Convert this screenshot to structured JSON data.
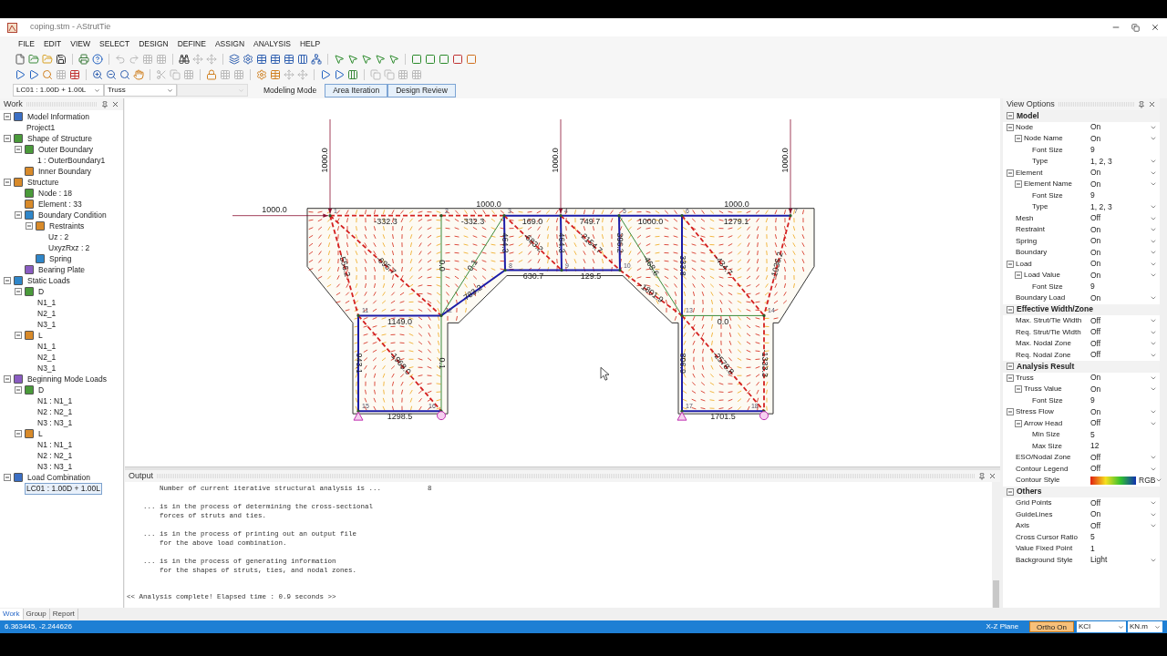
{
  "window": {
    "title": "coping.stm - AStrutTie"
  },
  "menu": [
    "FILE",
    "EDIT",
    "VIEW",
    "SELECT",
    "DESIGN",
    "DEFINE",
    "ASSIGN",
    "ANALYSIS",
    "HELP"
  ],
  "selector_bar": {
    "combination": "LC01 : 1.00D + 1.00L",
    "display": "Truss",
    "modes": [
      {
        "label": "Modeling Mode",
        "selected": false
      },
      {
        "label": "Area Iteration",
        "selected": true
      },
      {
        "label": "Design Review",
        "selected": true
      }
    ]
  },
  "work_panel": {
    "title": "Work",
    "tree": [
      {
        "label": "Model Information",
        "expanded": true,
        "selected": false,
        "children": [
          {
            "label": "Project1",
            "selected": false
          }
        ]
      },
      {
        "label": "Shape of Structure",
        "expanded": true,
        "selected": false,
        "children": [
          {
            "label": "Outer Boundary",
            "expanded": true,
            "selected": false,
            "children": [
              {
                "label": "1 : OuterBoundary1",
                "selected": false
              }
            ]
          },
          {
            "label": "Inner Boundary",
            "selected": false
          }
        ]
      },
      {
        "label": "Structure",
        "expanded": true,
        "selected": false,
        "children": [
          {
            "label": "Node : 18",
            "selected": false
          },
          {
            "label": "Element : 33",
            "selected": false
          },
          {
            "label": "Boundary Condition",
            "expanded": true,
            "selected": false,
            "children": [
              {
                "label": "Restraints",
                "expanded": true,
                "selected": false,
                "children": [
                  {
                    "label": "Uz : 2",
                    "selected": false
                  },
                  {
                    "label": "UxyzRxz : 2",
                    "selected": false
                  }
                ]
              },
              {
                "label": "Spring",
                "selected": false
              }
            ]
          },
          {
            "label": "Bearing Plate",
            "selected": false
          }
        ]
      },
      {
        "label": "Static Loads",
        "expanded": true,
        "selected": false,
        "children": [
          {
            "label": "D",
            "expanded": true,
            "selected": false,
            "children": [
              {
                "label": "N1_1",
                "selected": false
              },
              {
                "label": "N2_1",
                "selected": false
              },
              {
                "label": "N3_1",
                "selected": false
              }
            ]
          },
          {
            "label": "L",
            "expanded": true,
            "selected": false,
            "children": [
              {
                "label": "N1_1",
                "selected": false
              },
              {
                "label": "N2_1",
                "selected": false
              },
              {
                "label": "N3_1",
                "selected": false
              }
            ]
          }
        ]
      },
      {
        "label": "Beginning Mode Loads",
        "expanded": true,
        "selected": false,
        "children": [
          {
            "label": "D",
            "expanded": true,
            "selected": false,
            "children": [
              {
                "label": "N1 : N1_1",
                "selected": false
              },
              {
                "label": "N2 : N2_1",
                "selected": false
              },
              {
                "label": "N3 : N3_1",
                "selected": false
              }
            ]
          },
          {
            "label": "L",
            "expanded": true,
            "selected": false,
            "children": [
              {
                "label": "N1 : N1_1",
                "selected": false
              },
              {
                "label": "N2 : N2_1",
                "selected": false
              },
              {
                "label": "N3 : N3_1",
                "selected": false
              }
            ]
          }
        ]
      },
      {
        "label": "Load Combination",
        "expanded": true,
        "selected": false,
        "children": [
          {
            "label": "LC01 : 1.00D + 1.00L",
            "selected": true
          }
        ]
      }
    ],
    "tabs": [
      {
        "label": "Work",
        "selected": true
      },
      {
        "label": "Group",
        "selected": false
      },
      {
        "label": "Report",
        "selected": false
      }
    ]
  },
  "model_view": {
    "loads": [
      {
        "kind": "vertical",
        "value": "1000.0"
      },
      {
        "kind": "vertical",
        "value": "1000.0"
      },
      {
        "kind": "vertical",
        "value": "1000.0"
      },
      {
        "kind": "horizontal",
        "value": "1000.0"
      },
      {
        "kind": "note",
        "value": "1000.0"
      },
      {
        "kind": "note",
        "value": "1000.0"
      }
    ],
    "nodes": [
      "1",
      "2",
      "3",
      "4",
      "5",
      "6",
      "7",
      "8",
      "9",
      "10",
      "11",
      "12",
      "13",
      "14",
      "15",
      "16",
      "17",
      "18"
    ],
    "members": [
      {
        "kind": "strut",
        "force": "-332.3"
      },
      {
        "kind": "strut",
        "force": "-332.3"
      },
      {
        "kind": "tie",
        "force": "169.0"
      },
      {
        "kind": "tie",
        "force": "749.7"
      },
      {
        "kind": "tie",
        "force": "1000.0"
      },
      {
        "kind": "tie",
        "force": "1279.1"
      },
      {
        "kind": "strut",
        "force": "-556.2"
      },
      {
        "kind": "strut",
        "force": "-695.7"
      },
      {
        "kind": "zero",
        "force": "0.0"
      },
      {
        "kind": "zero",
        "force": "0.1"
      },
      {
        "kind": "tie",
        "force": "783.2"
      },
      {
        "kind": "tie",
        "force": "464.3"
      },
      {
        "kind": "strut",
        "force": "-683.2"
      },
      {
        "kind": "tie",
        "force": "464.3"
      },
      {
        "kind": "strut",
        "force": "-2154.7"
      },
      {
        "kind": "tie",
        "force": "396.2"
      },
      {
        "kind": "zero",
        "force": "-468.6"
      },
      {
        "kind": "strut",
        "force": "-1801.9"
      },
      {
        "kind": "tie",
        "force": "333.8"
      },
      {
        "kind": "strut",
        "force": "-434.7"
      },
      {
        "kind": "strut",
        "force": "-1036.2"
      },
      {
        "kind": "tie",
        "force": "630.7"
      },
      {
        "kind": "tie",
        "force": "129.5"
      },
      {
        "kind": "tie",
        "force": "1149.0"
      },
      {
        "kind": "zero",
        "force": "0.0"
      },
      {
        "kind": "tie",
        "force": "943.1"
      },
      {
        "kind": "strut",
        "force": "-1968.0"
      },
      {
        "kind": "zero",
        "force": "0.1"
      },
      {
        "kind": "tie",
        "force": "1298.5"
      },
      {
        "kind": "tie",
        "force": "806.9"
      },
      {
        "kind": "strut",
        "force": "-2578.8"
      },
      {
        "kind": "strut",
        "force": "-1333.3"
      },
      {
        "kind": "tie",
        "force": "1701.5"
      }
    ]
  },
  "output": {
    "title": "Output",
    "entries": [
      {
        "kind": "count",
        "text": "Number of current iterative structural analysis is ...",
        "value": "8"
      },
      {
        "kind": "step",
        "lines": [
          "... is in the process of determining the cross-sectional",
          "forces of struts and ties."
        ]
      },
      {
        "kind": "step",
        "lines": [
          "... is in the process of printing out an output file",
          "for the above load combination."
        ]
      },
      {
        "kind": "step",
        "lines": [
          "... is in the process of generating information",
          "for the shapes of struts, ties, and nodal zones."
        ]
      },
      {
        "kind": "summary",
        "text": "<< Analysis complete! Elapsed time : 0.9 seconds >>"
      }
    ]
  },
  "view_options": {
    "title": "View Options",
    "sections": [
      {
        "title": "Model",
        "expanded": true,
        "rows": [
          {
            "label": "Node",
            "value": "On",
            "dropdown": true,
            "expanded": true,
            "children": [
              {
                "label": "Node Name",
                "value": "On",
                "dropdown": true,
                "expanded": true,
                "children": [
                  {
                    "label": "Font Size",
                    "value": "9",
                    "dropdown": false
                  },
                  {
                    "label": "Type",
                    "value": "1, 2, 3",
                    "dropdown": true
                  }
                ]
              }
            ]
          },
          {
            "label": "Element",
            "value": "On",
            "dropdown": true,
            "expanded": true,
            "children": [
              {
                "label": "Element Name",
                "value": "On",
                "dropdown": true,
                "expanded": true,
                "children": [
                  {
                    "label": "Font Size",
                    "value": "9",
                    "dropdown": false
                  },
                  {
                    "label": "Type",
                    "value": "1, 2, 3",
                    "dropdown": true
                  }
                ]
              }
            ]
          },
          {
            "label": "Mesh",
            "value": "Off",
            "dropdown": true
          },
          {
            "label": "Restraint",
            "value": "On",
            "dropdown": true
          },
          {
            "label": "Spring",
            "value": "On",
            "dropdown": true
          },
          {
            "label": "Boundary",
            "value": "On",
            "dropdown": true
          },
          {
            "label": "Load",
            "value": "On",
            "dropdown": true,
            "expanded": true,
            "children": [
              {
                "label": "Load Value",
                "value": "On",
                "dropdown": true,
                "expanded": true,
                "children": [
                  {
                    "label": "Font Size",
                    "value": "9",
                    "dropdown": false
                  }
                ]
              }
            ]
          },
          {
            "label": "Boundary Load",
            "value": "On",
            "dropdown": true
          }
        ]
      },
      {
        "title": "Effective Width/Zone",
        "expanded": true,
        "rows": [
          {
            "label": "Max. Strut/Tie Width",
            "value": "Off",
            "dropdown": true
          },
          {
            "label": "Req. Strut/Tie Width",
            "value": "Off",
            "dropdown": true
          },
          {
            "label": "Max. Nodal Zone",
            "value": "Off",
            "dropdown": true
          },
          {
            "label": "Req. Nodal Zone",
            "value": "Off",
            "dropdown": true
          }
        ]
      },
      {
        "title": "Analysis Result",
        "expanded": true,
        "rows": [
          {
            "label": "Truss",
            "value": "On",
            "dropdown": true,
            "expanded": true,
            "children": [
              {
                "label": "Truss Value",
                "value": "On",
                "dropdown": true,
                "expanded": true,
                "children": [
                  {
                    "label": "Font Size",
                    "value": "9",
                    "dropdown": false
                  }
                ]
              }
            ]
          },
          {
            "label": "Stress Flow",
            "value": "On",
            "dropdown": true,
            "expanded": true,
            "children": [
              {
                "label": "Arrow Head",
                "value": "Off",
                "dropdown": true,
                "expanded": true,
                "children": [
                  {
                    "label": "Min Size",
                    "value": "5",
                    "dropdown": false
                  },
                  {
                    "label": "Max Size",
                    "value": "12",
                    "dropdown": false
                  }
                ]
              }
            ]
          },
          {
            "label": "ESO/Nodal Zone",
            "value": "Off",
            "dropdown": true
          },
          {
            "label": "Contour Legend",
            "value": "Off",
            "dropdown": true
          },
          {
            "label": "Contour Style",
            "value": "RGB",
            "dropdown": true,
            "gradient": true
          }
        ]
      },
      {
        "title": "Others",
        "expanded": true,
        "rows": [
          {
            "label": "Grid Points",
            "value": "Off",
            "dropdown": true
          },
          {
            "label": "GuideLines",
            "value": "On",
            "dropdown": true
          },
          {
            "label": "Axis",
            "value": "Off",
            "dropdown": true
          },
          {
            "label": "Cross Cursor Ratio",
            "value": "5",
            "dropdown": false
          },
          {
            "label": "Value Fixed Point",
            "value": "1",
            "dropdown": false
          },
          {
            "label": "Background Style",
            "value": "Light",
            "dropdown": true
          }
        ]
      }
    ]
  },
  "status_bar": {
    "coordinates": "6.363445, -2.244626",
    "plane": "X-Z Plane",
    "ortho": {
      "label": "Ortho On",
      "on": true
    },
    "code": "KCI",
    "unit": "KN.m"
  }
}
